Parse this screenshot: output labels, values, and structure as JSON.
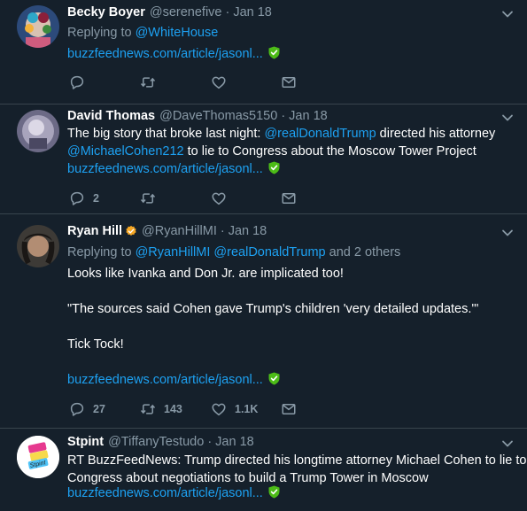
{
  "tweets": [
    {
      "name": "Becky Boyer",
      "handle": "@serenefive",
      "date": "Jan 18",
      "replying_label": "Replying to",
      "replying_to": "@WhiteHouse",
      "link": "buzzfeednews.com/article/jasonl...",
      "counts": {
        "reply": "",
        "retweet": "",
        "like": ""
      }
    },
    {
      "name": "David Thomas",
      "handle": "@DaveThomas5150",
      "date": "Jan 18",
      "text_1a": "The big story that broke last night: ",
      "text_1b": "@realDonaldTrump",
      "text_1c": " directed his attorney",
      "text_2a": "@MichaelCohen212",
      "text_2b": " to lie to Congress about the Moscow Tower Project",
      "link": "buzzfeednews.com/article/jasonl...",
      "counts": {
        "reply": "2",
        "retweet": "",
        "like": ""
      }
    },
    {
      "name": "Ryan Hill",
      "handle": "@RyanHillMI",
      "date": "Jan 18",
      "replying_label": "Replying to",
      "replying_to_1": "@RyanHillMI",
      "replying_to_2": "@realDonaldTrump",
      "replying_others": "and 2 others",
      "text_1": "Looks like Ivanka and Don Jr. are implicated too!",
      "text_2": "\"The sources said Cohen gave Trump's children 'very detailed updates.'\"",
      "text_3": "Tick Tock!",
      "link": "buzzfeednews.com/article/jasonl...",
      "counts": {
        "reply": "27",
        "retweet": "143",
        "like": "1.1K"
      }
    },
    {
      "name": "Stpint",
      "handle": "@TiffanyTestudo",
      "date": "Jan 18",
      "text_1": "RT BuzzFeedNews: Trump directed his longtime attorney Michael Cohen to lie to",
      "text_2": "Congress about negotiations to build a Trump Tower in Moscow",
      "link": "buzzfeednews.com/article/jasonl...",
      "avatar_logo_text": "Stpint"
    }
  ],
  "icons": {
    "reply": "reply-icon",
    "retweet": "retweet-icon",
    "like": "like-icon",
    "dm": "direct-message-icon",
    "chevron": "chevron-down-icon",
    "verified": "verified-badge-icon",
    "shield": "safe-link-shield-icon"
  },
  "colors": {
    "background": "#15202b",
    "link": "#1da1f2",
    "muted": "#8899a6",
    "shield": "#4cbb17",
    "divider": "#38444d"
  }
}
